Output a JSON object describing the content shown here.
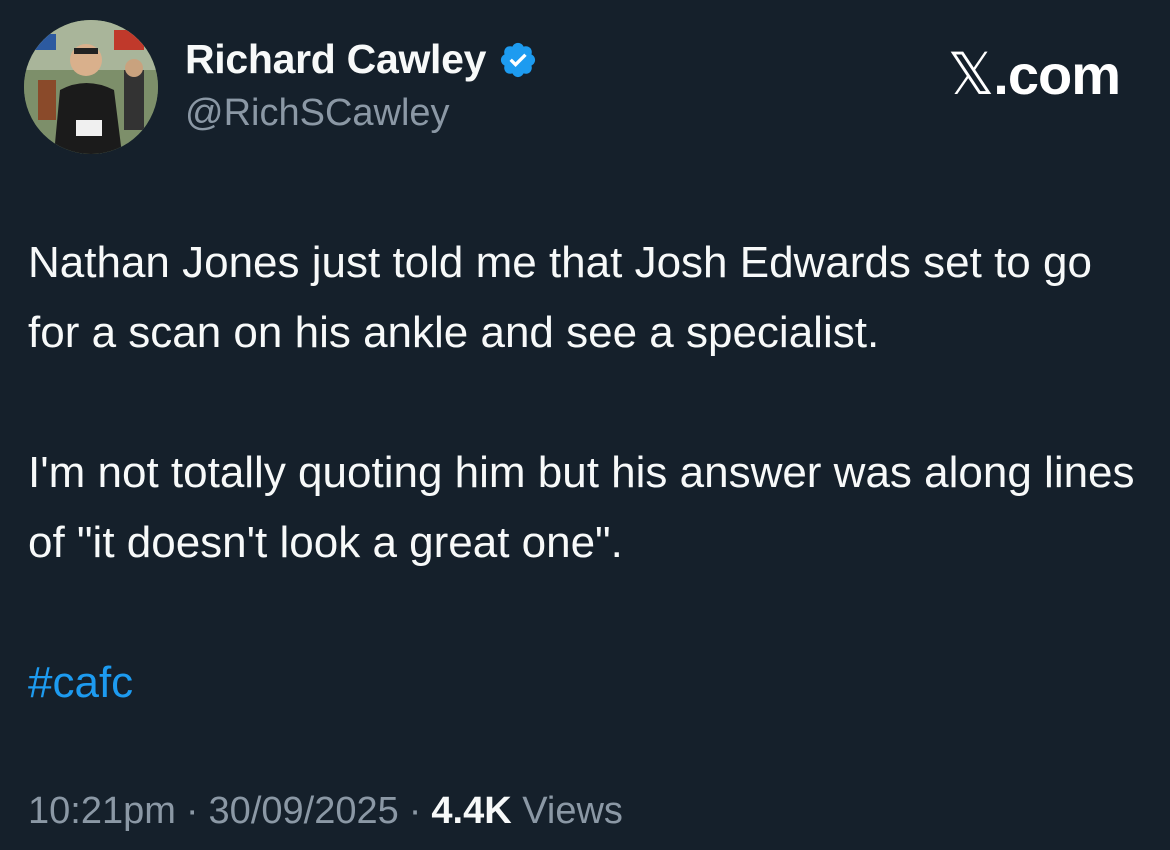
{
  "author": {
    "display_name": "Richard Cawley",
    "handle": "@RichSCawley",
    "verified": true,
    "avatar_icon": "runner-avatar"
  },
  "brand": {
    "label": ".com",
    "mark": "𝕏"
  },
  "tweet": {
    "paragraph_1": "Nathan Jones just told me that Josh Edwards set to go for a scan on his ankle and see a specialist.",
    "paragraph_2": "I'm not totally quoting him but his answer was along lines of \"it doesn't look a great one\".",
    "hashtag": "#cafc"
  },
  "meta": {
    "time": "10:21pm",
    "date": "30/09/2025",
    "separator": "·",
    "views_count": "4.4K",
    "views_label": "Views"
  },
  "colors": {
    "background": "#15202b",
    "text": "#f7f9f9",
    "secondary": "#8b98a5",
    "accent": "#1d9bf0"
  }
}
